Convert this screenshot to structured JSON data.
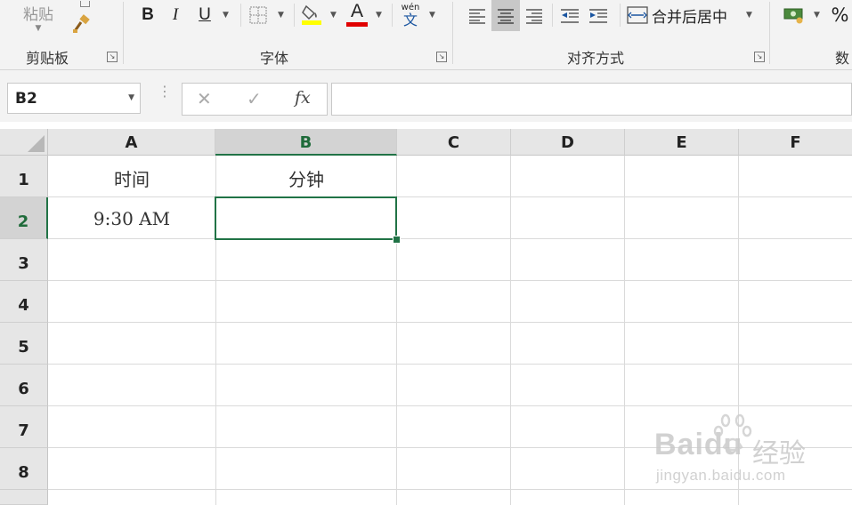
{
  "ribbon": {
    "clipboard": {
      "paste_label": "粘贴",
      "group_label": "剪贴板"
    },
    "font": {
      "group_label": "字体",
      "bold": "B",
      "italic": "I",
      "underline": "U",
      "font_color_glyph": "A",
      "phonetic_top": "wén",
      "phonetic_bottom": "文",
      "fill_color": "#ffff00",
      "font_color": "#e00000"
    },
    "alignment": {
      "group_label": "对齐方式",
      "merge_label": "合并后居中"
    },
    "number": {
      "group_label": "数",
      "percent": "%"
    }
  },
  "formula_bar": {
    "name_box": "B2",
    "cancel": "✕",
    "enter": "✓",
    "fx": "fx",
    "content": ""
  },
  "sheet": {
    "columns": [
      "A",
      "B",
      "C",
      "D",
      "E",
      "F"
    ],
    "rows": [
      "1",
      "2",
      "3",
      "4",
      "5",
      "6",
      "7",
      "8"
    ],
    "cells": {
      "A1": "时间",
      "B1": "分钟",
      "A2": "9:30 AM",
      "B2": ""
    },
    "active_cell": "B2",
    "accent": "#217346"
  },
  "watermark": {
    "brand": "Baidu",
    "brand_cn": "经验",
    "url": "jingyan.baidu.com"
  }
}
